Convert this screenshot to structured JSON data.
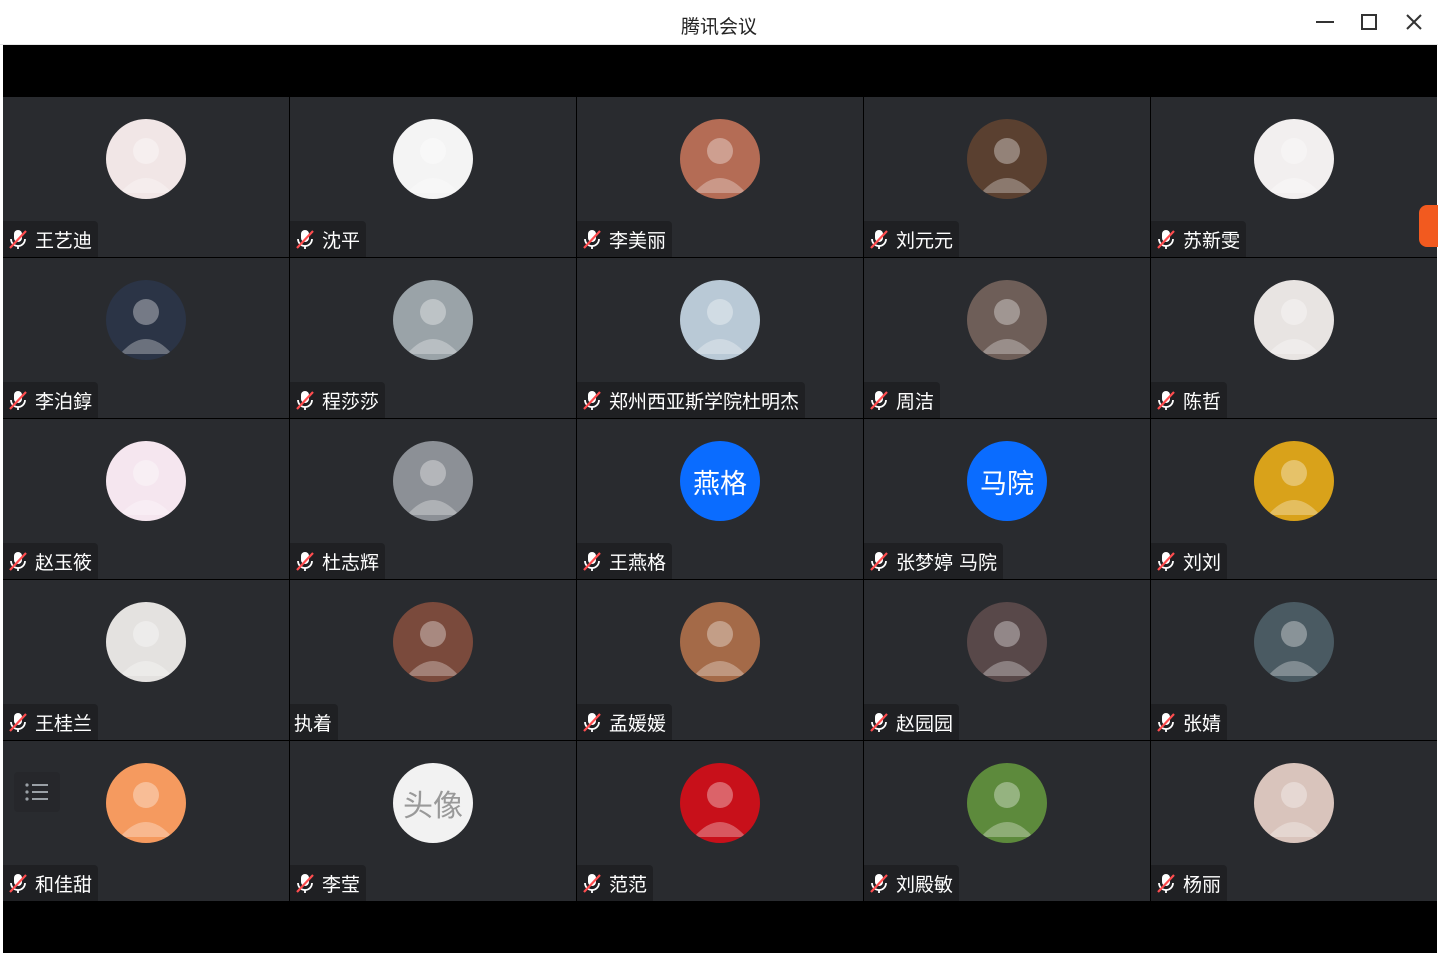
{
  "window": {
    "title": "腾讯会议",
    "minimize_icon": "minimize-icon",
    "maximize_icon": "maximize-icon",
    "close_icon": "close-icon"
  },
  "participants": [
    {
      "name": "王艺迪",
      "muted": true,
      "avatar": "photo-icon",
      "color": "#f1e6e6"
    },
    {
      "name": "沈平",
      "muted": true,
      "avatar": "photo-icon",
      "color": "#f4f4f4"
    },
    {
      "name": "李美丽",
      "muted": true,
      "avatar": "photo-icon",
      "color": "#b46c55"
    },
    {
      "name": "刘元元",
      "muted": true,
      "avatar": "photo-icon",
      "color": "#5a4030"
    },
    {
      "name": "苏新雯",
      "muted": true,
      "avatar": "photo-icon",
      "color": "#f2efef"
    },
    {
      "name": "李泊錞",
      "muted": true,
      "avatar": "photo-icon",
      "color": "#2b3446"
    },
    {
      "name": "程莎莎",
      "muted": true,
      "avatar": "photo-icon",
      "color": "#9aa3a8"
    },
    {
      "name": "郑州西亚斯学院杜明杰",
      "muted": true,
      "avatar": "photo-icon",
      "color": "#b9c9d6"
    },
    {
      "name": "周洁",
      "muted": true,
      "avatar": "photo-icon",
      "color": "#6e5e58"
    },
    {
      "name": "陈哲",
      "muted": true,
      "avatar": "photo-icon",
      "color": "#e8e4e2"
    },
    {
      "name": "赵玉筱",
      "muted": true,
      "avatar": "photo-icon",
      "color": "#f5e6ef"
    },
    {
      "name": "杜志辉",
      "muted": true,
      "avatar": "photo-icon",
      "color": "#8c9096"
    },
    {
      "name": "王燕格",
      "muted": true,
      "avatar": "text",
      "avatar_text": "燕格",
      "color": "#0a6cff"
    },
    {
      "name": "张梦婷 马院",
      "muted": true,
      "avatar": "text",
      "avatar_text": "马院",
      "color": "#0a6cff"
    },
    {
      "name": "刘刘",
      "muted": true,
      "avatar": "photo-icon",
      "color": "#d9a21a"
    },
    {
      "name": "王桂兰",
      "muted": true,
      "avatar": "photo-icon",
      "color": "#e4e2e0"
    },
    {
      "name": "执着",
      "muted": false,
      "avatar": "photo-icon",
      "color": "#7a4a3c"
    },
    {
      "name": "孟媛媛",
      "muted": true,
      "avatar": "photo-icon",
      "color": "#a46a48"
    },
    {
      "name": "赵园园",
      "muted": true,
      "avatar": "photo-icon",
      "color": "#584849"
    },
    {
      "name": "张婧",
      "muted": true,
      "avatar": "photo-icon",
      "color": "#4a5a62"
    },
    {
      "name": "和佳甜",
      "muted": true,
      "avatar": "photo-icon",
      "color": "#f59a5f"
    },
    {
      "name": "李莹",
      "muted": true,
      "avatar": "text-art",
      "avatar_text": "头像",
      "color": "#f2f2f2"
    },
    {
      "name": "范范",
      "muted": true,
      "avatar": "photo-icon",
      "color": "#c8101a"
    },
    {
      "name": "刘殿敏",
      "muted": true,
      "avatar": "photo-icon",
      "color": "#5d8a3c"
    },
    {
      "name": "杨丽",
      "muted": true,
      "avatar": "photo-icon",
      "color": "#d9c4bc"
    }
  ],
  "controls": {
    "list_icon": "list-icon"
  }
}
